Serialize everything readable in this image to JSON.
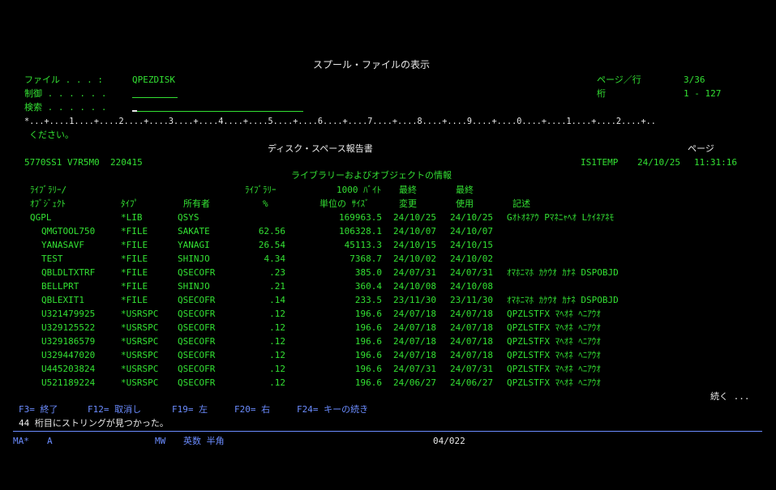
{
  "screen_title": "スプール・ファイルの表示",
  "file": {
    "label": "ファイル . . . :",
    "value": "QPEZDISK"
  },
  "control": {
    "label": "制御 . . . . . ."
  },
  "search": {
    "label": "検索 . . . . . ."
  },
  "page_line": {
    "label": "ページ／行",
    "value": "3/36"
  },
  "column": {
    "label": "桁",
    "value": "1 - 127"
  },
  "ruler": "*...+....1....+....2....+....3....+....4....+....5....+....6....+....7....+....8....+....9....+....0....+....1....+....2....+..",
  "continuation": "ください。",
  "report": {
    "title": "ディスク・スペース報告書",
    "page_label": "ページ",
    "product_id": "5770SS1 V7R5M0  220415",
    "system": "IS1TEMP",
    "date": "24/10/25",
    "time": "11:31:16",
    "section_title": "ライブラリーおよびオブジェクトの情報"
  },
  "headers1": {
    "lib": "ﾗｲﾌﾞﾗﾘｰ/",
    "libpct": "ﾗｲﾌﾞﾗﾘｰ",
    "size": "1000 ﾊﾞｲﾄ",
    "last1": "最終",
    "last2": "最終"
  },
  "headers2": {
    "obj": "ｵﾌﾞｼﾞｪｸﾄ",
    "type": "ﾀｲﾌﾟ",
    "owner": "所有者",
    "pct": "%",
    "size": "単位の ｻｲｽﾞ",
    "changed": "変更",
    "used": "使用",
    "desc": "記述"
  },
  "rows": [
    {
      "name": "QGPL",
      "type": "*LIB",
      "owner": "QSYS",
      "pct": "",
      "size": "169963.5",
      "changed": "24/10/25",
      "used": "24/10/25",
      "desc": "Gｵﾄｵﾈｱｳ Pﾏﾈﾆｬﾍｵ Lｹｲﾈｱﾈﾓ"
    },
    {
      "name": "QMGTOOL750",
      "type": "*FILE",
      "owner": "SAKATE",
      "pct": "62.56",
      "size": "106328.1",
      "changed": "24/10/07",
      "used": "24/10/07",
      "desc": ""
    },
    {
      "name": "YANASAVF",
      "type": "*FILE",
      "owner": "YANAGI",
      "pct": "26.54",
      "size": "45113.3",
      "changed": "24/10/15",
      "used": "24/10/15",
      "desc": ""
    },
    {
      "name": "TEST",
      "type": "*FILE",
      "owner": "SHINJO",
      "pct": "4.34",
      "size": "7368.7",
      "changed": "24/10/02",
      "used": "24/10/02",
      "desc": ""
    },
    {
      "name": "QBLDLTXTRF",
      "type": "*FILE",
      "owner": "QSECOFR",
      "pct": ".23",
      "size": "385.0",
      "changed": "24/07/31",
      "used": "24/07/31",
      "desc": "ｵﾏﾎﾆﾏﾎ ｶｹｳｵ ｶﾅﾈ DSPOBJD"
    },
    {
      "name": "BELLPRT",
      "type": "*FILE",
      "owner": "SHINJO",
      "pct": ".21",
      "size": "360.4",
      "changed": "24/10/08",
      "used": "24/10/08",
      "desc": ""
    },
    {
      "name": "QBLEXIT1",
      "type": "*FILE",
      "owner": "QSECOFR",
      "pct": ".14",
      "size": "233.5",
      "changed": "23/11/30",
      "used": "23/11/30",
      "desc": "ｵﾏﾎﾆﾏﾎ ｶｹｳｵ ｶﾅﾈ DSPOBJD"
    },
    {
      "name": "U321479925",
      "type": "*USRSPC",
      "owner": "QSECOFR",
      "pct": ".12",
      "size": "196.6",
      "changed": "24/07/18",
      "used": "24/07/18",
      "desc": "QPZLSTFX ﾏﾍｵﾈ ﾍﾆｱｳｵ"
    },
    {
      "name": "U329125522",
      "type": "*USRSPC",
      "owner": "QSECOFR",
      "pct": ".12",
      "size": "196.6",
      "changed": "24/07/18",
      "used": "24/07/18",
      "desc": "QPZLSTFX ﾏﾍｵﾈ ﾍﾆｱｳｵ"
    },
    {
      "name": "U329186579",
      "type": "*USRSPC",
      "owner": "QSECOFR",
      "pct": ".12",
      "size": "196.6",
      "changed": "24/07/18",
      "used": "24/07/18",
      "desc": "QPZLSTFX ﾏﾍｵﾈ ﾍﾆｱｳｵ"
    },
    {
      "name": "U329447020",
      "type": "*USRSPC",
      "owner": "QSECOFR",
      "pct": ".12",
      "size": "196.6",
      "changed": "24/07/18",
      "used": "24/07/18",
      "desc": "QPZLSTFX ﾏﾍｵﾈ ﾍﾆｱｳｵ"
    },
    {
      "name": "U445203824",
      "type": "*USRSPC",
      "owner": "QSECOFR",
      "pct": ".12",
      "size": "196.6",
      "changed": "24/07/31",
      "used": "24/07/31",
      "desc": "QPZLSTFX ﾏﾍｵﾈ ﾍﾆｱｳｵ"
    },
    {
      "name": "U521189224",
      "type": "*USRSPC",
      "owner": "QSECOFR",
      "pct": ".12",
      "size": "196.6",
      "changed": "24/06/27",
      "used": "24/06/27",
      "desc": "QPZLSTFX ﾏﾍｵﾈ ﾍﾆｱｳｵ"
    }
  ],
  "more": "続く ...",
  "fkeys": [
    {
      "label": "F3= 終了"
    },
    {
      "label": "F12= 取消し"
    },
    {
      "label": "F19= 左"
    },
    {
      "label": "F20= 右"
    },
    {
      "label": "F24= キーの続き"
    }
  ],
  "message": "44 桁目にストリングが見つかった。",
  "status": {
    "mode": "MA*",
    "field": "A",
    "mw": "MW",
    "input": "英数 半角",
    "cursor_pos": "04/022"
  }
}
